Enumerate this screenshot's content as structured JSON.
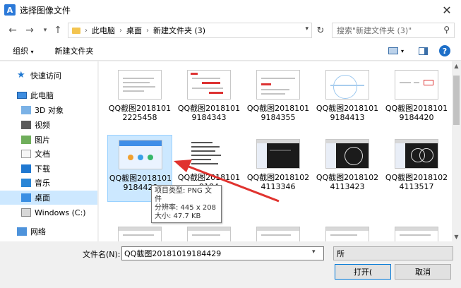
{
  "window": {
    "title": "选择图像文件",
    "app_icon": "A"
  },
  "nav": {
    "breadcrumb": [
      "此电脑",
      "桌面",
      "新建文件夹 (3)"
    ],
    "search_placeholder": "搜索\"新建文件夹 (3)\""
  },
  "toolbar": {
    "organize": "组织",
    "new_folder": "新建文件夹"
  },
  "sidebar": {
    "items": [
      {
        "label": "快速访问",
        "icon": "star-icon"
      },
      {
        "label": "此电脑",
        "icon": "computer-icon"
      },
      {
        "label": "3D 对象",
        "icon": "3d-objects-icon"
      },
      {
        "label": "视频",
        "icon": "video-icon"
      },
      {
        "label": "图片",
        "icon": "pictures-icon"
      },
      {
        "label": "文档",
        "icon": "documents-icon"
      },
      {
        "label": "下载",
        "icon": "download-icon"
      },
      {
        "label": "音乐",
        "icon": "music-icon"
      },
      {
        "label": "桌面",
        "icon": "desktop-icon",
        "selected": true
      },
      {
        "label": "Windows (C:)",
        "icon": "drive-icon"
      },
      {
        "label": "网络",
        "icon": "network-icon"
      }
    ]
  },
  "files": [
    {
      "name": "QQ截图20181012225458",
      "thumb": "web"
    },
    {
      "name": "QQ截图20181019184343",
      "thumb": "web-red"
    },
    {
      "name": "QQ截图20181019184355",
      "thumb": "web"
    },
    {
      "name": "QQ截图20181019184413",
      "thumb": "diagram"
    },
    {
      "name": "QQ截图20181019184420",
      "thumb": "form"
    },
    {
      "name": "QQ截图20181019184429",
      "thumb": "app",
      "selected": true
    },
    {
      "name": "QQ截图20181019184",
      "thumb": "text"
    },
    {
      "name": "QQ截图20181024113346",
      "thumb": "cad"
    },
    {
      "name": "QQ截图20181024113423",
      "thumb": "cad"
    },
    {
      "name": "QQ截图20181024113517",
      "thumb": "cad"
    },
    {
      "name": "",
      "thumb": "web"
    },
    {
      "name": "",
      "thumb": "web"
    },
    {
      "name": "",
      "thumb": "web"
    },
    {
      "name": "",
      "thumb": "web"
    },
    {
      "name": "",
      "thumb": "web"
    }
  ],
  "tooltip": {
    "type": "项目类型: PNG 文件",
    "resolution": "分辨率: 445 x 208",
    "size": "大小: 47.7 KB"
  },
  "bottom": {
    "filename_label": "文件名(N):",
    "filename_value": "QQ截图20181019184429",
    "filetype_value": "所",
    "open_label": "打开(",
    "cancel_label": "取消"
  },
  "colors": {
    "selection": "#cce8ff",
    "accent": "#0078d7",
    "arrow": "#e0332f"
  }
}
